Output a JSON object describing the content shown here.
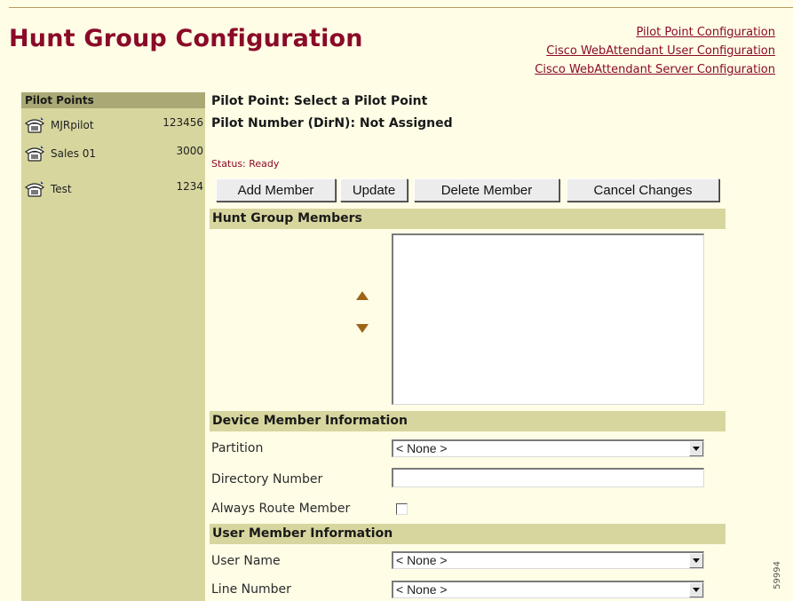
{
  "page": {
    "title": "Hunt Group Configuration",
    "links": [
      "Pilot Point Configuration",
      "Cisco WebAttendant User Configuration",
      "Cisco WebAttendant Server Configuration"
    ],
    "figure_id": "59994"
  },
  "sidebar": {
    "heading": "Pilot Points",
    "items": [
      {
        "name": "MJRpilot",
        "number": "123456",
        "icon": "phone-icon"
      },
      {
        "name": "Sales 01",
        "number": "3000",
        "icon": "phone-icon"
      },
      {
        "name": "Test",
        "number": "1234",
        "icon": "phone-icon"
      }
    ]
  },
  "main": {
    "pilot_point": "Pilot Point: Select a Pilot Point",
    "pilot_number": "Pilot Number (DirN): Not Assigned",
    "status": "Status: Ready",
    "buttons": {
      "add": "Add Member",
      "update": "Update",
      "delete": "Delete Member",
      "cancel": "Cancel Changes"
    },
    "sections": {
      "members": "Hunt Group Members",
      "device": "Device Member Information",
      "user": "User Member Information"
    },
    "fields": {
      "partition_label": "Partition",
      "partition_value": "< None >",
      "directory_label": "Directory Number",
      "directory_value": "",
      "always_route_label": "Always Route Member",
      "user_name_label": "User Name",
      "user_name_value": "< None >",
      "line_number_label": "Line Number",
      "line_number_value": "< None >"
    }
  },
  "colors": {
    "title": "#8a0a28",
    "background": "#fffde6",
    "sidebar": "#d7d69f",
    "sidebar_header": "#aaa976",
    "arrows": "#a0631a"
  }
}
